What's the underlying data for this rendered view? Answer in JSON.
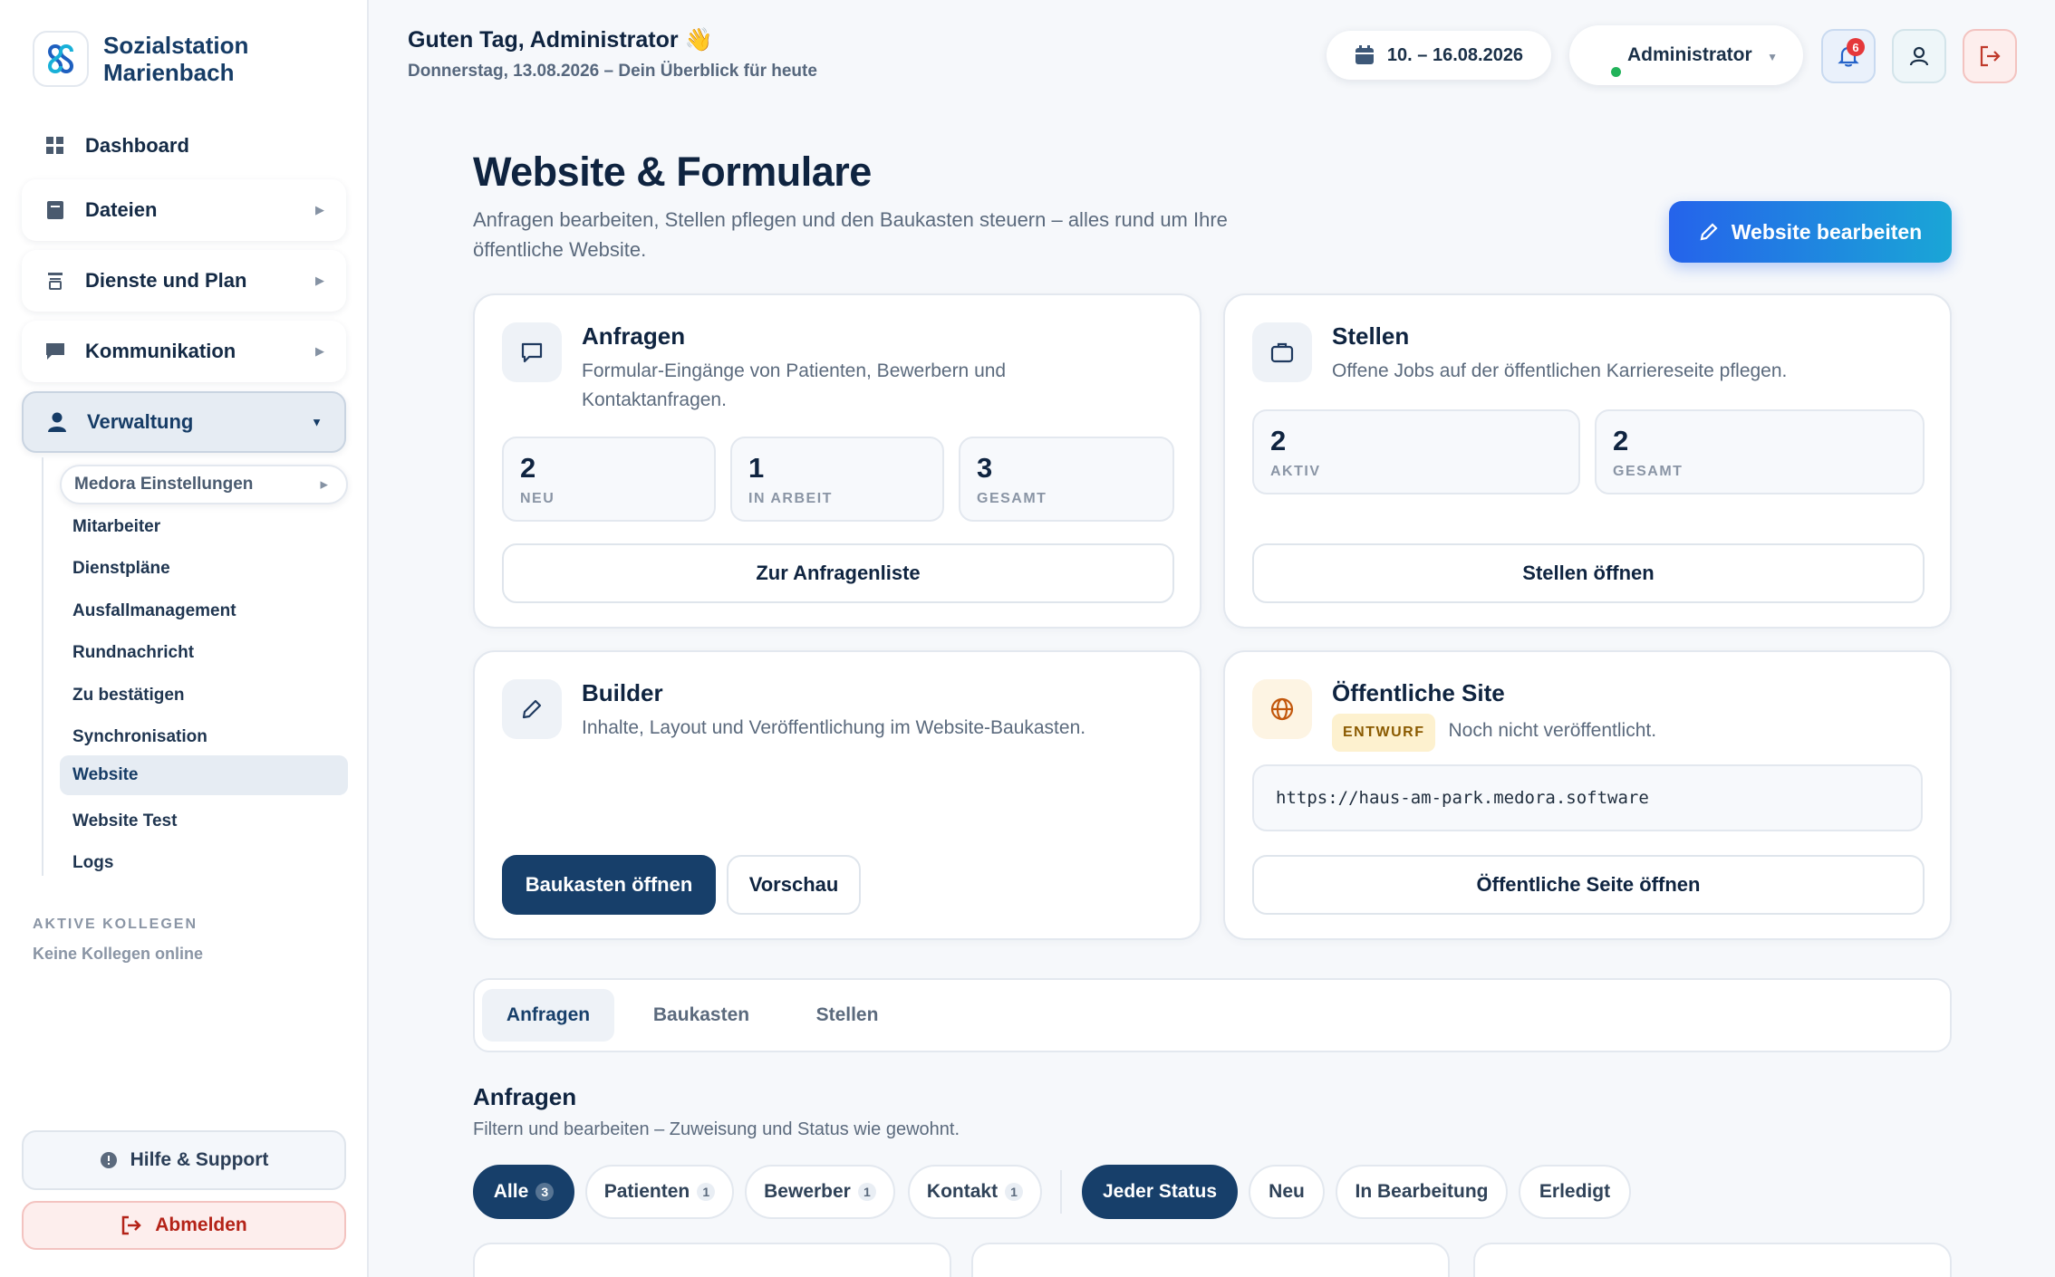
{
  "brand": {
    "line1": "Sozialstation",
    "line2": "Marienbach"
  },
  "nav": {
    "dashboard": "Dashboard",
    "files": "Dateien",
    "shifts": "Dienste und Plan",
    "communication": "Kommunikation",
    "admin": "Verwaltung"
  },
  "subnav": [
    "Medora Einstellungen",
    "Mitarbeiter",
    "Dienstpläne",
    "Ausfallmanagement",
    "Rundnachricht",
    "Zu bestätigen",
    "Synchronisation",
    "Website",
    "Website Test",
    "Logs"
  ],
  "active_colleagues": {
    "heading": "AKTIVE KOLLEGEN",
    "empty": "Keine Kollegen online"
  },
  "sidebar_footer": {
    "help": "Hilfe & Support",
    "logout": "Abmelden"
  },
  "header": {
    "greeting": "Guten Tag, Administrator",
    "greeting_emoji": "👋",
    "subline": "Donnerstag, 13.08.2026 – Dein Überblick für heute",
    "date_range": "10. – 16.08.2026",
    "user": "Administrator",
    "notifications": "6"
  },
  "page": {
    "title": "Website & Formulare",
    "subtitle": "Anfragen bearbeiten, Stellen pflegen und den Baukasten steuern – alles rund um Ihre öffentliche Website.",
    "edit_button": "Website bearbeiten"
  },
  "cards": {
    "requests": {
      "title": "Anfragen",
      "desc": "Formular-Eingänge von Patienten, Bewerbern und Kontaktanfragen.",
      "stats": [
        {
          "value": "2",
          "label": "NEU"
        },
        {
          "value": "1",
          "label": "IN ARBEIT"
        },
        {
          "value": "3",
          "label": "GESAMT"
        }
      ],
      "button": "Zur Anfragenliste"
    },
    "jobs": {
      "title": "Stellen",
      "desc": "Offene Jobs auf der öffentlichen Karriereseite pflegen.",
      "stats": [
        {
          "value": "2",
          "label": "AKTIV"
        },
        {
          "value": "2",
          "label": "GESAMT"
        }
      ],
      "button": "Stellen öffnen"
    },
    "builder": {
      "title": "Builder",
      "desc": "Inhalte, Layout und Veröffentlichung im Website-Baukasten.",
      "primary": "Baukasten öffnen",
      "secondary": "Vorschau"
    },
    "public": {
      "title": "Öffentliche Site",
      "badge": "ENTWURF",
      "status": "Noch nicht veröffentlicht.",
      "url": "https://haus-am-park.medora.software",
      "button": "Öffentliche Seite öffnen"
    }
  },
  "tabs": [
    "Anfragen",
    "Baukasten",
    "Stellen"
  ],
  "section": {
    "title": "Anfragen",
    "subtitle": "Filtern und bearbeiten – Zuweisung und Status wie gewohnt."
  },
  "type_filters": [
    {
      "label": "Alle",
      "count": "3"
    },
    {
      "label": "Patienten",
      "count": "1"
    },
    {
      "label": "Bewerber",
      "count": "1"
    },
    {
      "label": "Kontakt",
      "count": "1"
    }
  ],
  "status_filters": [
    "Jeder Status",
    "Neu",
    "In Bearbeitung",
    "Erledigt"
  ],
  "colors": {
    "primary": "#173f6a",
    "accent": "#2563eb",
    "danger": "#b42318",
    "online": "#22b35a"
  }
}
